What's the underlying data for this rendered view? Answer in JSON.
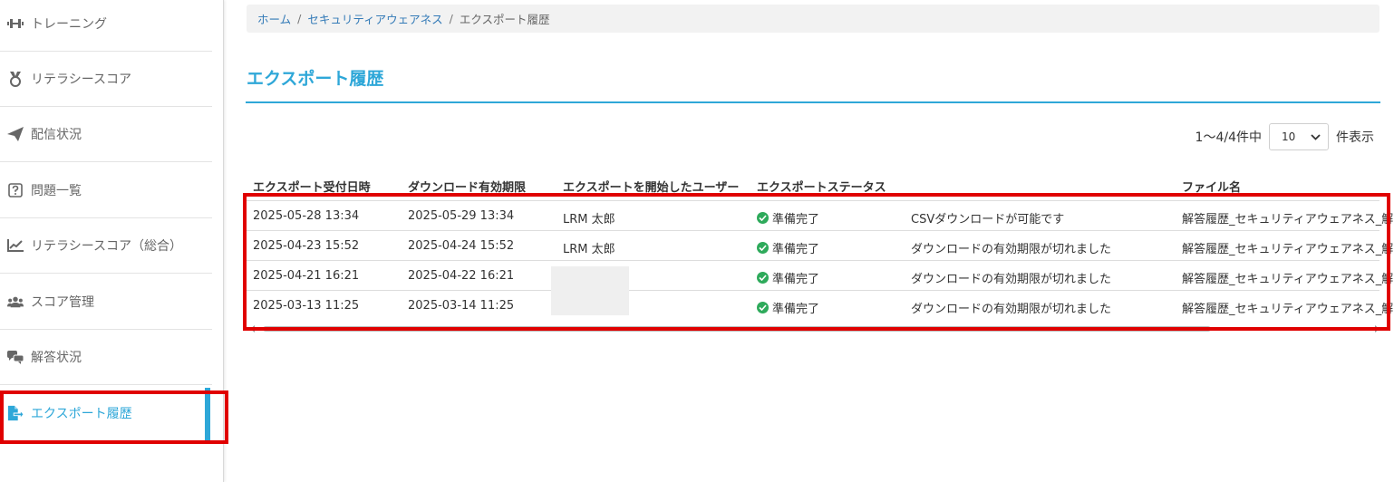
{
  "sidebar": {
    "items": [
      {
        "label": "トレーニング",
        "icon": "dumbbell-icon"
      },
      {
        "label": "リテラシースコア",
        "icon": "medal-icon"
      },
      {
        "label": "配信状況",
        "icon": "paper-plane-icon"
      },
      {
        "label": "問題一覧",
        "icon": "question-square-icon"
      },
      {
        "label": "リテラシースコア（総合）",
        "icon": "chart-line-icon"
      },
      {
        "label": "スコア管理",
        "icon": "users-icon"
      },
      {
        "label": "解答状況",
        "icon": "comments-icon"
      },
      {
        "label": "エクスポート履歴",
        "icon": "file-export-icon"
      }
    ]
  },
  "breadcrumb": {
    "home": "ホーム",
    "separator": "/",
    "section": "セキュリティアウェアネス",
    "current": "エクスポート履歴"
  },
  "page": {
    "title": "エクスポート履歴"
  },
  "pagination": {
    "range_text": "1〜4/4件中",
    "page_size": "10",
    "suffix": "件表示"
  },
  "table": {
    "headers": [
      "エクスポート受付日時",
      "ダウンロード有効期限",
      "エクスポートを開始したユーザー",
      "エクスポートステータス",
      "ファイル名"
    ],
    "rows": [
      {
        "received": "2025-05-28 13:34",
        "expires": "2025-05-29 13:34",
        "user": "LRM 太郎",
        "status": "準備完了",
        "message": "CSVダウンロードが可能です",
        "file": "解答履歴_セキュリティアウェアネス_解"
      },
      {
        "received": "2025-04-23 15:52",
        "expires": "2025-04-24 15:52",
        "user": "LRM 太郎",
        "status": "準備完了",
        "message": "ダウンロードの有効期限が切れました",
        "file": "解答履歴_セキュリティアウェアネス_解"
      },
      {
        "received": "2025-04-21 16:21",
        "expires": "2025-04-22 16:21",
        "user": "",
        "status": "準備完了",
        "message": "ダウンロードの有効期限が切れました",
        "file": "解答履歴_セキュリティアウェアネス_解"
      },
      {
        "received": "2025-03-13 11:25",
        "expires": "2025-03-14 11:25",
        "user": "",
        "status": "準備完了",
        "message": "ダウンロードの有効期限が切れました",
        "file": "解答履歴_セキュリティアウェアネス_解"
      }
    ]
  },
  "colors": {
    "accent": "#2ea7d8",
    "link": "#337ab7",
    "success": "#2eaa5b",
    "highlight": "#e00000"
  }
}
